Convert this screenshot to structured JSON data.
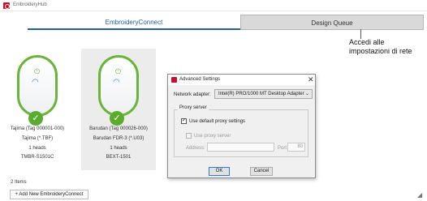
{
  "app": {
    "title": "EmbroideryHub"
  },
  "tabs": {
    "embroidery_connect": "EmbroideryConnect",
    "design_queue": "Design Queue"
  },
  "annotation": {
    "line1": "Accedi alle",
    "line2": "impostazioni di rete"
  },
  "devices": [
    {
      "name_tag": "Tajima  (Tag 000001-000)",
      "format": "Tajima (*.TBF)",
      "heads": "1 heads",
      "model": "TMBR-S1501C"
    },
    {
      "name_tag": "Barudan  (Tag 000026-000)",
      "format": "Barudan FDR-3 (*.U03)",
      "heads": "1 heads",
      "model": "BEXT-1501"
    }
  ],
  "footer": {
    "items_count": "2 Items",
    "add_button": "+ Add New EmbroideryConnect"
  },
  "dialog": {
    "title": "Advanced Settings",
    "close_glyph": "✕",
    "network_adapter_label": "Network adapter:",
    "network_adapter_value": "Intel(R) PRO/1000 MT Desktop Adapter",
    "proxy_group_label": "Proxy server",
    "use_default_label": "Use default proxy settings",
    "use_default_checked": true,
    "use_proxy_label": "Use proxy server",
    "use_proxy_checked": false,
    "address_label": "Address:",
    "port_label": "Port",
    "port_value": "80",
    "ok_label": "OK",
    "cancel_label": "Cancel"
  },
  "icons": {
    "power": "power-icon",
    "wifi": "wifi-icon",
    "check": "check-icon",
    "resize": "resize-grip-icon"
  },
  "colors": {
    "device_green": "#69b53a",
    "accent_blue": "#1e5f9c",
    "brand_red": "#c8102e"
  }
}
